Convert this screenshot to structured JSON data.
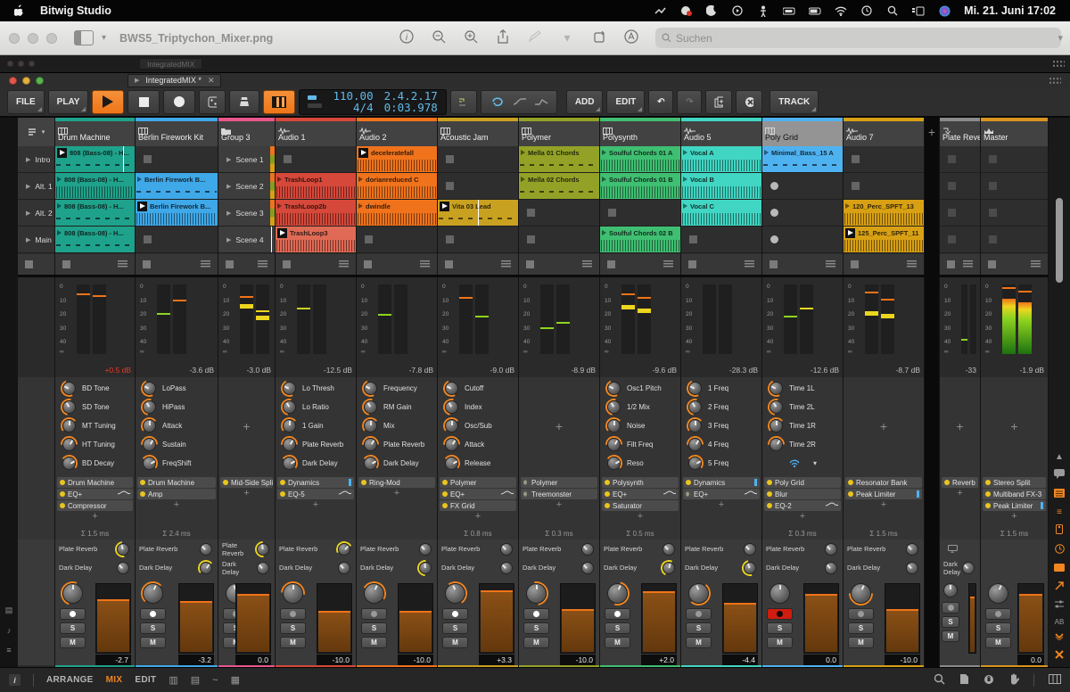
{
  "menubar": {
    "app_name": "Bitwig Studio",
    "datetime": "Mi. 21. Juni  17:02",
    "status_icons": [
      "screen-record-icon",
      "app-red-badge-icon",
      "focus-moon-icon",
      "media-play-icon",
      "accessibility-icon",
      "keyboard-brightness-icon",
      "battery-icon",
      "wifi-icon",
      "clock-icon",
      "search-icon",
      "stage-manager-icon",
      "siri-icon"
    ]
  },
  "preview": {
    "title": "BWS5_Triptychon_Mixer.png",
    "search_placeholder": "Suchen",
    "toolbar_icons": [
      "info-icon",
      "zoom-out-icon",
      "zoom-in-icon",
      "share-icon",
      "markup-pencil-icon",
      "chevron-icon",
      "crop-rotate-icon",
      "annotate-icon"
    ]
  },
  "bitwig": {
    "bg_tab": "IntegratedMIX",
    "tab": "IntegratedMIX *",
    "transport": {
      "file": "FILE",
      "play": "PLAY",
      "add": "ADD",
      "edit": "EDIT",
      "track": "TRACK",
      "tempo": "110.00",
      "timesig": "4/4",
      "position": "2.4.2.17",
      "time": "0:03.978"
    },
    "scenes": [
      "Intro",
      "Alt. 1",
      "Alt. 2",
      "Main"
    ],
    "send_labels": [
      "Plate Reverb",
      "Dark Delay"
    ],
    "tracks": [
      {
        "type": "scenes",
        "width": 42
      },
      {
        "name": "Drum Machine",
        "width": 90,
        "role": "inst",
        "color": "#1FA28B",
        "clips": [
          {
            "t": "808 (Bass-08) - H...",
            "s": "playing",
            "wf": "notes",
            "prog": 0.85
          },
          {
            "t": "808 (Bass-08) - H...",
            "s": "stopped",
            "wf": "wave"
          },
          {
            "t": "808 (Bass-08) - H...",
            "s": "stopped",
            "wf": "notes"
          },
          {
            "t": "808 (Bass-08) - H...",
            "s": "stopped",
            "wf": "notes"
          }
        ],
        "meter": {
          "l": 62,
          "r": 58,
          "pl": 85,
          "plc": "#f07318",
          "pr": 82,
          "prc": "#f07318",
          "label": "+0.5 dB",
          "red": true
        },
        "knobs": [
          "BD Tone",
          "SD Tone",
          "MT Tuning",
          "HT Tuning",
          "BD Decay"
        ],
        "devices": [
          {
            "n": "Drum Machine"
          },
          {
            "n": "EQ+",
            "curve": true
          },
          {
            "n": "Compressor"
          }
        ],
        "latency": "Σ 1.5 ms",
        "sends": [
          0.3,
          0
        ],
        "rec": "white",
        "fader": "-2.7",
        "fill": 76
      },
      {
        "name": "Berlin Firework Kit",
        "width": 93,
        "role": "inst",
        "color": "#3FA8E8",
        "clips": [
          {
            "s": "empty"
          },
          {
            "t": "Berlin Firework B...",
            "s": "stopped",
            "wf": "notes"
          },
          {
            "t": "Berlin Firework B...",
            "s": "playing",
            "wf": "wave"
          },
          {
            "s": "empty"
          }
        ],
        "meter": {
          "l": 40,
          "r": 56,
          "pl": 57,
          "plc": "#8ed41f",
          "pr": 76,
          "prc": "#f07318",
          "label": "-3.6 dB"
        },
        "knobs": [
          "LoPass",
          "HiPass",
          "Attack",
          "Sustain",
          "FreqShift"
        ],
        "devices": [
          {
            "n": "Drum Machine"
          },
          {
            "n": "Amp"
          }
        ],
        "latency": "Σ 2.4 ms",
        "sends": [
          0,
          0.8
        ],
        "rec": "white",
        "fader": "-3.2",
        "fill": 74
      },
      {
        "name": "Group 3",
        "width": 64,
        "role": "group",
        "color": "#E8568C",
        "clips": [
          {
            "s": "scene",
            "t": "Scene 1"
          },
          {
            "s": "scene",
            "t": "Scene 2"
          },
          {
            "s": "scene",
            "t": "Scene 3"
          },
          {
            "s": "scene",
            "t": "Scene 4",
            "prog": 0.93
          }
        ],
        "meter": {
          "l": 72,
          "r": 55,
          "pl": 81,
          "plc": "#f07318",
          "pr": 60,
          "prc": "#ecd51f",
          "band": true,
          "label": "-3.0 dB"
        },
        "knobs": [],
        "devices": [
          {
            "n": "Mid-Side Split"
          }
        ],
        "latency": "",
        "sends": [
          0.35,
          0
        ],
        "rec": "grey",
        "fader": "0.0",
        "fill": 84
      },
      {
        "name": "Audio 1",
        "width": 91,
        "role": "audio",
        "color": "#D6483A",
        "clips": [
          {
            "s": "empty"
          },
          {
            "t": "TrashLoop1",
            "s": "stopped",
            "wf": "wave"
          },
          {
            "t": "TrashLoop2b",
            "s": "stopped",
            "wf": "wave"
          },
          {
            "t": "TrashLoop3",
            "s": "playing",
            "wf": "wave",
            "c": "#E06A55"
          }
        ],
        "meter": {
          "l": 57,
          "r": 52,
          "pl": 64,
          "plc": "#c8d41f",
          "pr": 0,
          "prc": "",
          "label": "-12.5 dB"
        },
        "knobs": [
          "Lo Thresh",
          "Lo Ratio",
          "1 Gain",
          "Plate Reverb",
          "Dark Delay"
        ],
        "devices": [
          {
            "n": "Dynamics",
            "blue": true
          },
          {
            "n": "EQ-5",
            "curve": true
          }
        ],
        "latency": "",
        "sends": [
          0.9,
          0
        ],
        "rec": "grey",
        "fader": "-10.0",
        "fill": 60
      },
      {
        "name": "Audio 2",
        "width": 91,
        "role": "audio",
        "color": "#F0731C",
        "clips": [
          {
            "t": "deceleratefall",
            "s": "playing",
            "wf": "wave"
          },
          {
            "t": "dorianreduced  C",
            "s": "stopped",
            "wf": "wave"
          },
          {
            "t": "dwindle",
            "s": "stopped",
            "wf": "wave"
          },
          {
            "s": "empty"
          }
        ],
        "meter": {
          "l": 48,
          "r": 40,
          "pl": 55,
          "plc": "#8ed41f",
          "pr": 0,
          "prc": "",
          "label": "-7.8 dB"
        },
        "knobs": [
          "Frequency",
          "RM Gain",
          "Mix",
          "Plate Reverb",
          "Dark Delay"
        ],
        "devices": [
          {
            "n": "Ring-Mod"
          }
        ],
        "latency": "",
        "sends": [
          0,
          0.4
        ],
        "rec": "grey",
        "fader": "-10.0",
        "fill": 60
      },
      {
        "name": "Acoustic Jam",
        "width": 91,
        "role": "inst",
        "color": "#C9A120",
        "clips": [
          {
            "s": "empty"
          },
          {
            "s": "empty"
          },
          {
            "t": "Vita 03 Lead",
            "s": "playing",
            "wf": "notes",
            "prog": 0.5
          },
          {
            "s": "empty"
          }
        ],
        "meter": {
          "l": 70,
          "r": 45,
          "pl": 79,
          "plc": "#f07318",
          "pr": 52,
          "prc": "#8ed41f",
          "label": "-9.0 dB"
        },
        "knobs": [
          "Cutoff",
          "Index",
          "Osc/Sub",
          "Attack",
          "Release"
        ],
        "devices": [
          {
            "n": "Polymer"
          },
          {
            "n": "EQ+",
            "curve": true
          },
          {
            "n": "FX Grid"
          }
        ],
        "latency": "Σ 0.8 ms",
        "sends": [
          0,
          0
        ],
        "rec": "white",
        "fader": "+3.3",
        "fill": 90
      },
      {
        "name": "Polymer",
        "width": 91,
        "role": "inst",
        "color": "#93A226",
        "clips": [
          {
            "t": "Mella 01 Chords",
            "s": "stopped",
            "wf": "notes"
          },
          {
            "t": "Mella 02 Chords",
            "s": "stopped",
            "wf": "notes"
          },
          {
            "s": "empty"
          },
          {
            "s": "empty"
          }
        ],
        "meter": {
          "l": 14,
          "r": 9,
          "pl": 36,
          "plc": "#8ed41f",
          "pr": 43,
          "prc": "#8ed41f",
          "label": "-8.9 dB"
        },
        "knobs": [],
        "devices": [
          {
            "n": "Polymer",
            "off": true
          },
          {
            "n": "Treemonster",
            "off": true
          }
        ],
        "latency": "Σ 0.3 ms",
        "sends": [
          0,
          0
        ],
        "rec": "white",
        "fader": "-10.0",
        "fill": 62
      },
      {
        "name": "Polysynth",
        "width": 91,
        "role": "inst",
        "color": "#3FBF72",
        "clips": [
          {
            "t": "Soulful Chords 01 A",
            "s": "stopped",
            "wf": "wave"
          },
          {
            "t": "Soulful Chords 01 B",
            "s": "stopped",
            "wf": "wave"
          },
          {
            "s": "empty"
          },
          {
            "t": "Soulful Chords 02 B",
            "s": "stopped",
            "wf": "wave"
          }
        ],
        "meter": {
          "l": 70,
          "r": 66,
          "pl": 84,
          "plc": "#f07318",
          "pr": 79,
          "prc": "#f07318",
          "band": true,
          "label": "-9.6 dB"
        },
        "knobs": [
          "Osc1 Pitch",
          "1/2 Mix",
          "Noise",
          "Filt Freq",
          "Reso"
        ],
        "devices": [
          {
            "n": "Polysynth"
          },
          {
            "n": "EQ+",
            "curve": true
          },
          {
            "n": "Saturator"
          }
        ],
        "latency": "Σ 0.5 ms",
        "sends": [
          0,
          0.6
        ],
        "rec": "white",
        "fader": "+2.0",
        "fill": 88
      },
      {
        "name": "Audio 5",
        "width": 91,
        "role": "audio",
        "color": "#41D6C3",
        "clips": [
          {
            "t": "Vocal A",
            "s": "stopped",
            "wf": "wave"
          },
          {
            "t": "Vocal B",
            "s": "stopped",
            "wf": "wave"
          },
          {
            "t": "Vocal C",
            "s": "stopped",
            "wf": "wave"
          },
          {
            "s": "empty"
          }
        ],
        "meter": {
          "l": 3,
          "r": 2,
          "pl": 0,
          "plc": "",
          "pr": 0,
          "prc": "",
          "label": "-28.3 dB"
        },
        "knobs": [
          "1 Freq",
          "2 Freq",
          "3 Freq",
          "4 Freq",
          "5 Freq"
        ],
        "devices": [
          {
            "n": "Dynamics",
            "blue": true
          },
          {
            "n": "EQ+",
            "off": true,
            "curve": true
          }
        ],
        "latency": "",
        "sends": [
          0,
          0.25
        ],
        "rec": "grey",
        "fader": "-4.4",
        "fill": 72
      },
      {
        "name": "Poly Grid",
        "width": 91,
        "role": "inst",
        "color": "#4FB2F0",
        "selected": true,
        "wifi": true,
        "clips": [
          {
            "t": "Minimal_Bass_15 A",
            "s": "stopped",
            "wf": "notes"
          },
          {
            "s": "empty-round"
          },
          {
            "s": "empty-round"
          },
          {
            "s": "empty-round"
          }
        ],
        "meter": {
          "l": 46,
          "r": 56,
          "pl": 53,
          "plc": "#8ed41f",
          "pr": 64,
          "prc": "#ecd51f",
          "label": "-12.6 dB"
        },
        "knobs": [
          "Time 1L",
          "Time 2L",
          "Time 1R",
          "Time 2R"
        ],
        "devices": [
          {
            "n": "Poly Grid"
          },
          {
            "n": "Blur"
          },
          {
            "n": "EQ-2",
            "curve": true
          }
        ],
        "latency": "Σ 0.3 ms",
        "sends": [
          0,
          0
        ],
        "rec": "red",
        "fader": "0.0",
        "fill": 84
      },
      {
        "name": "Audio 7",
        "width": 91,
        "role": "audio",
        "color": "#D8A013",
        "clips": [
          {
            "s": "empty"
          },
          {
            "s": "empty"
          },
          {
            "t": "120_Perc_SPFT_13",
            "s": "stopped",
            "wf": "wave"
          },
          {
            "t": "125_Perc_SPFT_11",
            "s": "playing",
            "wf": "wave"
          }
        ],
        "meter": {
          "l": 62,
          "r": 58,
          "pl": 87,
          "plc": "#f07318",
          "pr": 77,
          "prc": "#f07318",
          "band": true,
          "label": "-8.7 dB"
        },
        "knobs": [],
        "devices": [
          {
            "n": "Resonator Bank"
          },
          {
            "n": "Peak Limiter",
            "blue": true
          }
        ],
        "latency": "Σ 1.5 ms",
        "sends": [
          0,
          0
        ],
        "rec": "grey",
        "fader": "-10.0",
        "fill": 62
      },
      {
        "type": "gap",
        "width": 17,
        "add_label": "+"
      },
      {
        "name": "Plate Reve",
        "width": 46,
        "role": "fx",
        "color": "#8A8A8A",
        "clips": [
          {
            "s": "empty"
          },
          {
            "s": "empty"
          },
          {
            "s": "empty"
          },
          {
            "s": "empty"
          }
        ],
        "meter": {
          "l": 12,
          "r": 8,
          "pl": 19,
          "plc": "#8ed41f",
          "pr": 0,
          "prc": "",
          "label": "-33"
        },
        "knobs": [],
        "devices": [
          {
            "n": "Reverb"
          }
        ],
        "latency": "",
        "sends": [
          null,
          0
        ],
        "rec": "grey",
        "fader": "",
        "fill": 80
      },
      {
        "name": "Master",
        "width": 76,
        "role": "master",
        "color": "#D8941F",
        "clips": [
          {
            "s": "empty"
          },
          {
            "s": "empty"
          },
          {
            "s": "empty"
          },
          {
            "s": "empty"
          }
        ],
        "meter": {
          "l": 80,
          "r": 74,
          "pl": 93,
          "plc": "#f07318",
          "pr": 88,
          "prc": "#f07318",
          "hot": true,
          "label": "-1.9 dB"
        },
        "knobs": [],
        "devices": [
          {
            "n": "Stereo Split"
          },
          {
            "n": "Multiband FX-3"
          },
          {
            "n": "Peak Limiter",
            "blue": true
          }
        ],
        "latency": "Σ 1.5 ms",
        "sends": null,
        "rec": "grey",
        "fader": "0.0",
        "fill": 85
      }
    ],
    "right_rail_icons": [
      "scroll-up-icon",
      "comment-bubble-icon",
      "browser-grid-icon",
      "mixer-view-icon",
      "device-view-icon",
      "clock-icon",
      "active-panel-icon",
      "arrow-up-right-icon",
      "crossfade-icon",
      "ab-compare-icon",
      "chevron-down-icon",
      "close-x-icon"
    ],
    "left_rail_icons": [
      "mixer-strip-icon",
      "note-icon",
      "list-icon"
    ],
    "statusbar": {
      "tabs": [
        "ARRANGE",
        "MIX",
        "EDIT"
      ],
      "active": "MIX",
      "right_icons": [
        "search-icon",
        "file-icon",
        "lock-icon",
        "hand-icon",
        "piano-icon"
      ]
    }
  }
}
